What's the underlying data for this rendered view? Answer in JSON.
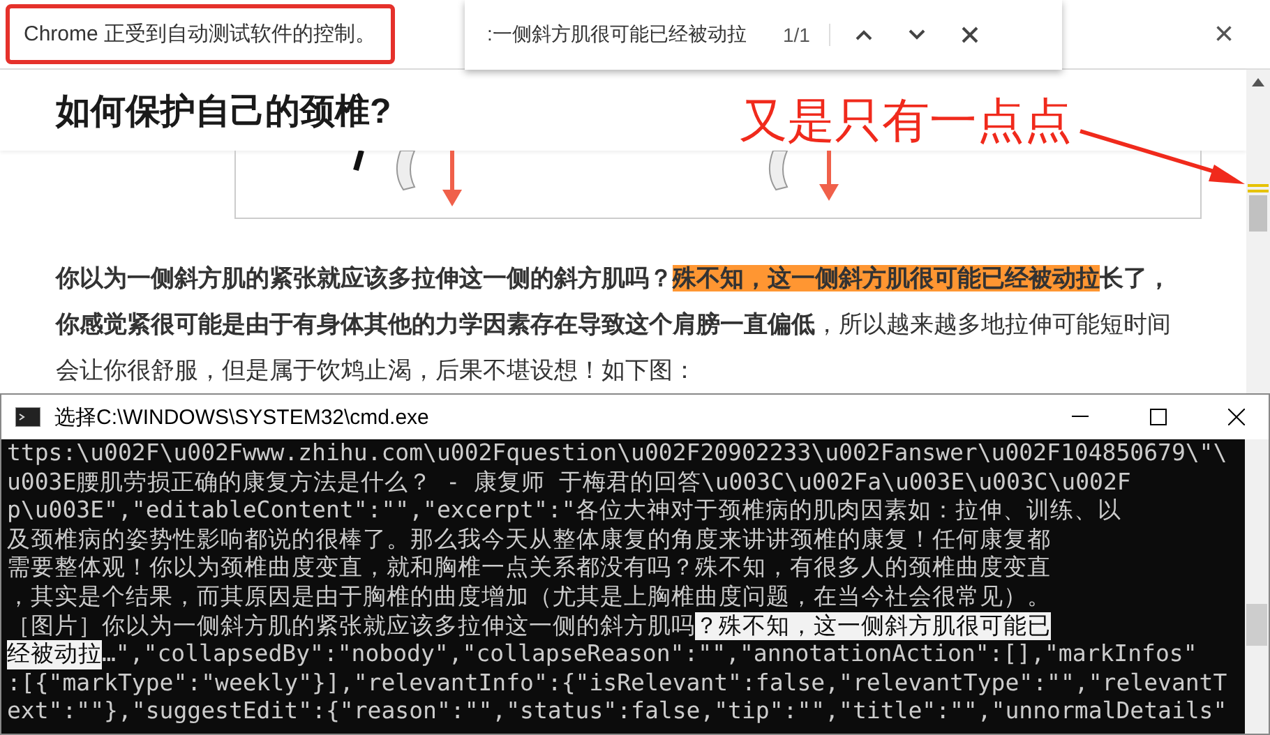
{
  "infobar": {
    "message": "Chrome 正受到自动测试软件的控制。",
    "close": "×"
  },
  "find_bar": {
    "query": ":一侧斜方肌很可能已经被动拉",
    "count": "1/1"
  },
  "article": {
    "title": "如何保护自己的颈椎?",
    "paragraph": [
      {
        "text": "你以为一侧斜方肌的紧张就应该多拉伸这一侧的斜方肌吗？",
        "kind": "bold"
      },
      {
        "text": "殊不知，这一侧斜方肌很可能已经被动拉",
        "kind": "match"
      },
      {
        "text": "长了，你感觉紧很可能是由于有身体其他的力学因素存在导致这个肩膀一直偏低",
        "kind": "bold"
      },
      {
        "text": "，所以越来越多地拉伸可能短时间会让你很舒服，但是属于饮鸩止渴，后果不堪设想！如下图：",
        "kind": "normal"
      }
    ]
  },
  "annotation": "又是只有一点点",
  "console": {
    "title": "选择C:\\WINDOWS\\SYSTEM32\\cmd.exe",
    "lines": [
      [
        {
          "text": "ttps:\\u002F\\u002Fwww.zhihu.com\\u002Fquestion\\u002F20902233\\u002Fanswer\\u002F104850679\\\"\\",
          "selected": false
        }
      ],
      [
        {
          "text": "u003E腰肌劳损正确的康复方法是什么？ - 康复师 于梅君的回答\\u003C\\u002Fa\\u003E\\u003C\\u002F",
          "selected": false
        }
      ],
      [
        {
          "text": "p\\u003E\",\"editableContent\":\"\",\"excerpt\":\"各位大神对于颈椎病的肌肉因素如：拉伸、训练、以",
          "selected": false
        }
      ],
      [
        {
          "text": "及颈椎病的姿势性影响都说的很棒了。那么我今天从整体康复的角度来讲讲颈椎的康复！任何康复都",
          "selected": false
        }
      ],
      [
        {
          "text": "需要整体观！你以为颈椎曲度变直，就和胸椎一点关系都没有吗？殊不知，有很多人的颈椎曲度变直",
          "selected": false
        }
      ],
      [
        {
          "text": "，其实是个结果，而其原因是由于胸椎的曲度增加（尤其是上胸椎曲度问题，在当今社会很常见）。",
          "selected": false
        }
      ],
      [
        {
          "text": "［图片］你以为一侧斜方肌的紧张就应该多拉伸这一侧的斜方肌吗",
          "selected": false
        },
        {
          "text": "？殊不知，这一侧斜方肌很可能已",
          "selected": true
        }
      ],
      [
        {
          "text": "经被动拉",
          "selected": true
        },
        {
          "text": "…\",\"collapsedBy\":\"nobody\",\"collapseReason\":\"\",\"annotationAction\":[],\"markInfos\"",
          "selected": false
        }
      ],
      [
        {
          "text": ":[{\"markType\":\"weekly\"}],\"relevantInfo\":{\"isRelevant\":false,\"relevantType\":\"\",\"relevantT",
          "selected": false
        }
      ],
      [
        {
          "text": "ext\":\"\"},\"suggestEdit\":{\"reason\":\"\",\"status\":false,\"tip\":\"\",\"title\":\"\",\"unnormalDetails\"",
          "selected": false
        }
      ]
    ]
  }
}
